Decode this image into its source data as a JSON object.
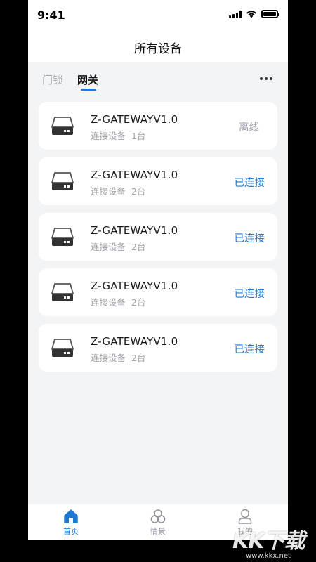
{
  "status_bar": {
    "time": "9:41"
  },
  "nav": {
    "title": "所有设备"
  },
  "tabs": [
    {
      "label": "门锁",
      "active": false
    },
    {
      "label": "网关",
      "active": true
    }
  ],
  "devices": [
    {
      "name": "Z-GATEWAYV1.0",
      "connected_label": "连接设备",
      "count": "1台",
      "status": "离线",
      "online": false
    },
    {
      "name": "Z-GATEWAYV1.0",
      "connected_label": "连接设备",
      "count": "2台",
      "status": "已连接",
      "online": true
    },
    {
      "name": "Z-GATEWAYV1.0",
      "connected_label": "连接设备",
      "count": "2台",
      "status": "已连接",
      "online": true
    },
    {
      "name": "Z-GATEWAYV1.0",
      "connected_label": "连接设备",
      "count": "2台",
      "status": "已连接",
      "online": true
    },
    {
      "name": "Z-GATEWAYV1.0",
      "connected_label": "连接设备",
      "count": "2台",
      "status": "已连接",
      "online": true
    }
  ],
  "tabbar": {
    "home": "首页",
    "scene": "情景",
    "mine": "我的"
  },
  "watermark": {
    "logo": "KK下载",
    "url": "www.kkx.net"
  },
  "colors": {
    "accent": "#1f78d1",
    "muted": "#9ea3aa",
    "background": "#f3f4f6"
  },
  "icons": {
    "status": [
      "signal-icon",
      "wifi-icon",
      "battery-icon"
    ],
    "device": "gateway-device-icon",
    "more": "more-dots-icon",
    "tabbar": [
      "home-icon",
      "scene-icon",
      "user-icon"
    ]
  }
}
